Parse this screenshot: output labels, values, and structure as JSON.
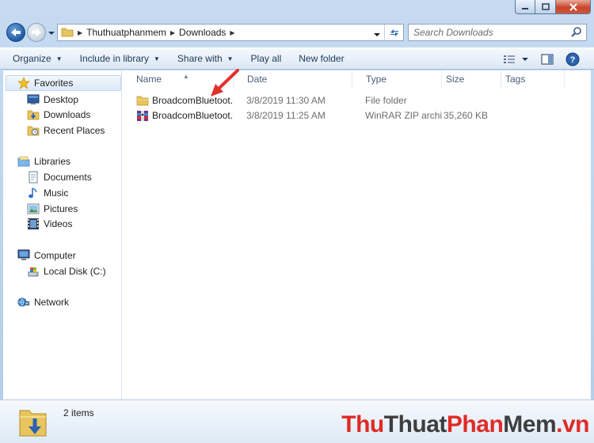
{
  "address": {
    "crumbs": [
      "Thuthuatphanmem",
      "Downloads"
    ],
    "search_placeholder": "Search Downloads"
  },
  "command_bar": {
    "organize": "Organize",
    "include_in_library": "Include in library",
    "share_with": "Share with",
    "play_all": "Play all",
    "new_folder": "New folder"
  },
  "nav": {
    "favorites": "Favorites",
    "desktop": "Desktop",
    "downloads": "Downloads",
    "recent_places": "Recent Places",
    "libraries": "Libraries",
    "documents": "Documents",
    "music": "Music",
    "pictures": "Pictures",
    "videos": "Videos",
    "computer": "Computer",
    "local_disk": "Local Disk (C:)",
    "network": "Network"
  },
  "columns": {
    "name": "Name",
    "date": "Date",
    "type": "Type",
    "size": "Size",
    "tags": "Tags"
  },
  "files": [
    {
      "name": "BroadcomBluetoot...",
      "date": "3/8/2019 11:30 AM",
      "type": "File folder",
      "size": "",
      "icon": "folder-icon"
    },
    {
      "name": "BroadcomBluetoot...",
      "date": "3/8/2019 11:25 AM",
      "type": "WinRAR ZIP archive",
      "size": "35,260 KB",
      "icon": "winrar-archive-icon"
    }
  ],
  "details": {
    "item_count": "2 items"
  },
  "watermark": {
    "part1": "Thu",
    "part2": "Thuat",
    "part3": "Phan",
    "part4": "Mem",
    "part5": ".vn"
  },
  "colors": {
    "accent_red": "#e02a25",
    "header_text": "#4c607a",
    "command_text": "#1e395b"
  }
}
